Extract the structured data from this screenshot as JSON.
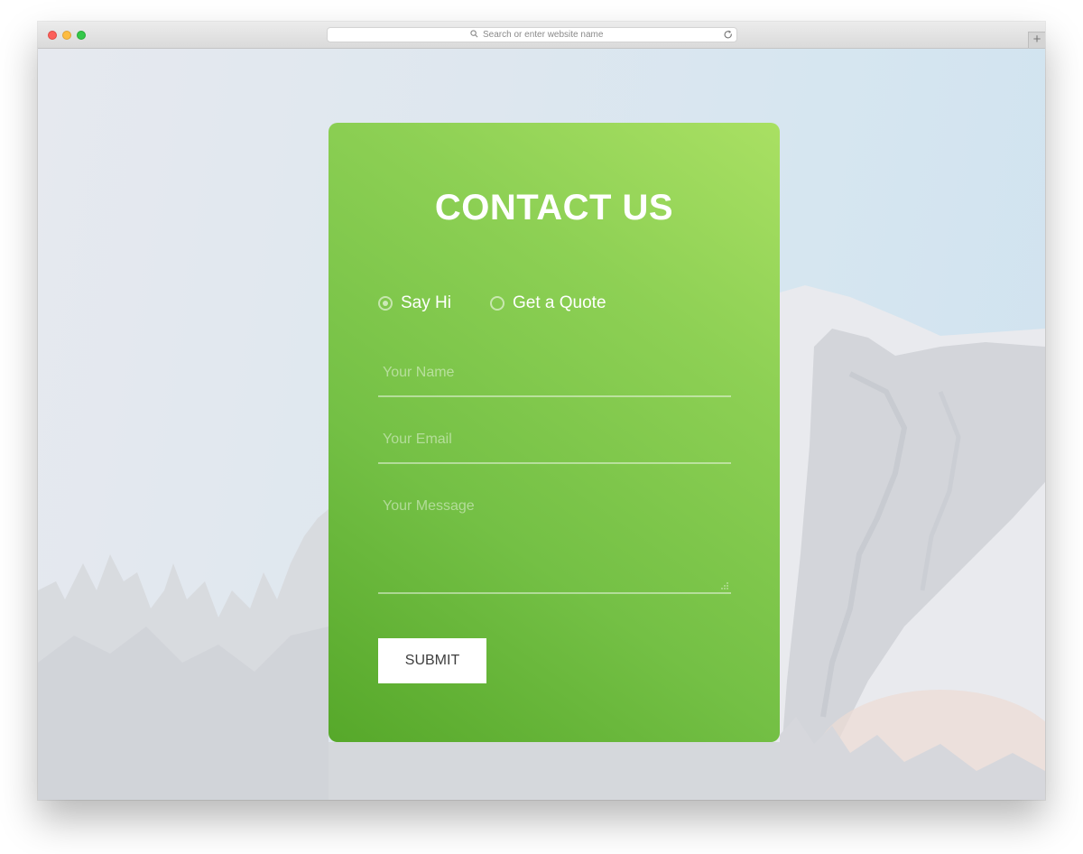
{
  "browser": {
    "address_placeholder": "Search or enter website name",
    "new_tab_symbol": "+"
  },
  "contact_form": {
    "title": "CONTACT US",
    "radio_options": [
      {
        "label": "Say Hi",
        "selected": true
      },
      {
        "label": "Get a Quote",
        "selected": false
      }
    ],
    "name_placeholder": "Your Name",
    "email_placeholder": "Your Email",
    "message_placeholder": "Your Message",
    "submit_label": "SUBMIT"
  },
  "colors": {
    "card_gradient_start": "#a9e063",
    "card_gradient_end": "#56a82a",
    "text": "#ffffff",
    "button_bg": "#ffffff",
    "button_text": "#3e3e3e"
  },
  "icons": [
    "search-icon",
    "reload-icon",
    "resize-handle-icon"
  ]
}
